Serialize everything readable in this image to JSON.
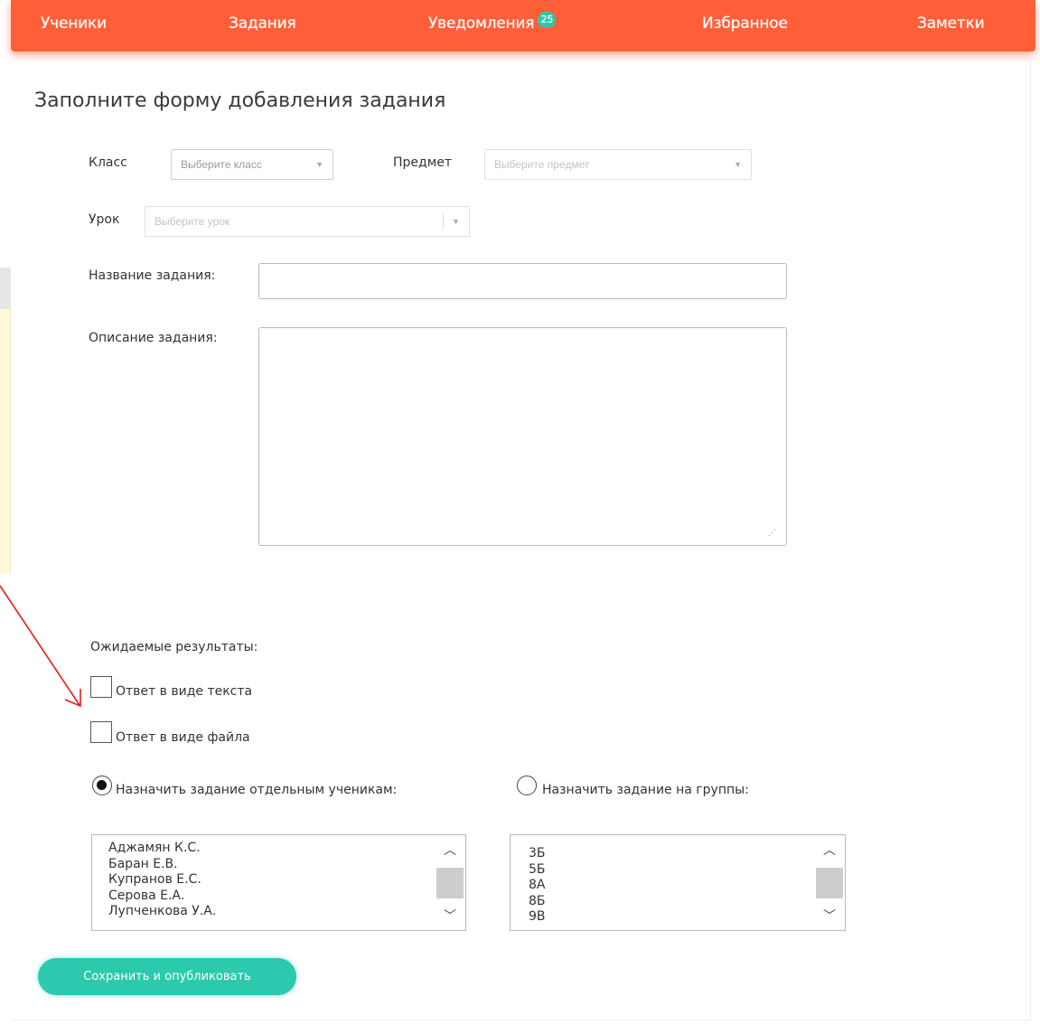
{
  "nav": {
    "items": [
      {
        "label": "Ученики"
      },
      {
        "label": "Задания"
      },
      {
        "label": "Уведомления",
        "badge": "25"
      },
      {
        "label": "Избранное"
      },
      {
        "label": "Заметки"
      }
    ]
  },
  "page": {
    "title": "Заполните форму добавления задания"
  },
  "form": {
    "class_label": "Класс",
    "class_placeholder": "Выберите класс",
    "subject_label": "Предмет",
    "subject_placeholder": "Выберите предмет",
    "lesson_label": "Урок",
    "lesson_placeholder": "Выберите урок",
    "task_name_label": "Название задания:",
    "task_name_value": "",
    "task_desc_label": "Описание задания:",
    "task_desc_value": "",
    "expected_label": "Ожидаемые результаты:",
    "answer_text_label": "Ответ в виде текста",
    "answer_file_label": "Ответ в виде файла",
    "assign_students_label": "Назначить задание отдельным ученикам:",
    "assign_groups_label": "Назначить задание на группы:",
    "students": [
      "Аджамян К.С.",
      "Баран Е.В.",
      "Купранов Е.С.",
      "Серова Е.А.",
      "Лупченкова У.А."
    ],
    "groups": [
      "3Б",
      "5Б",
      "8А",
      "8Б",
      "9В"
    ],
    "save_label": "Сохранить и опубликовать"
  },
  "colors": {
    "nav_bg": "#ff5f38",
    "accent": "#2bc9ad",
    "annotation_arrow": "#e0201c"
  }
}
